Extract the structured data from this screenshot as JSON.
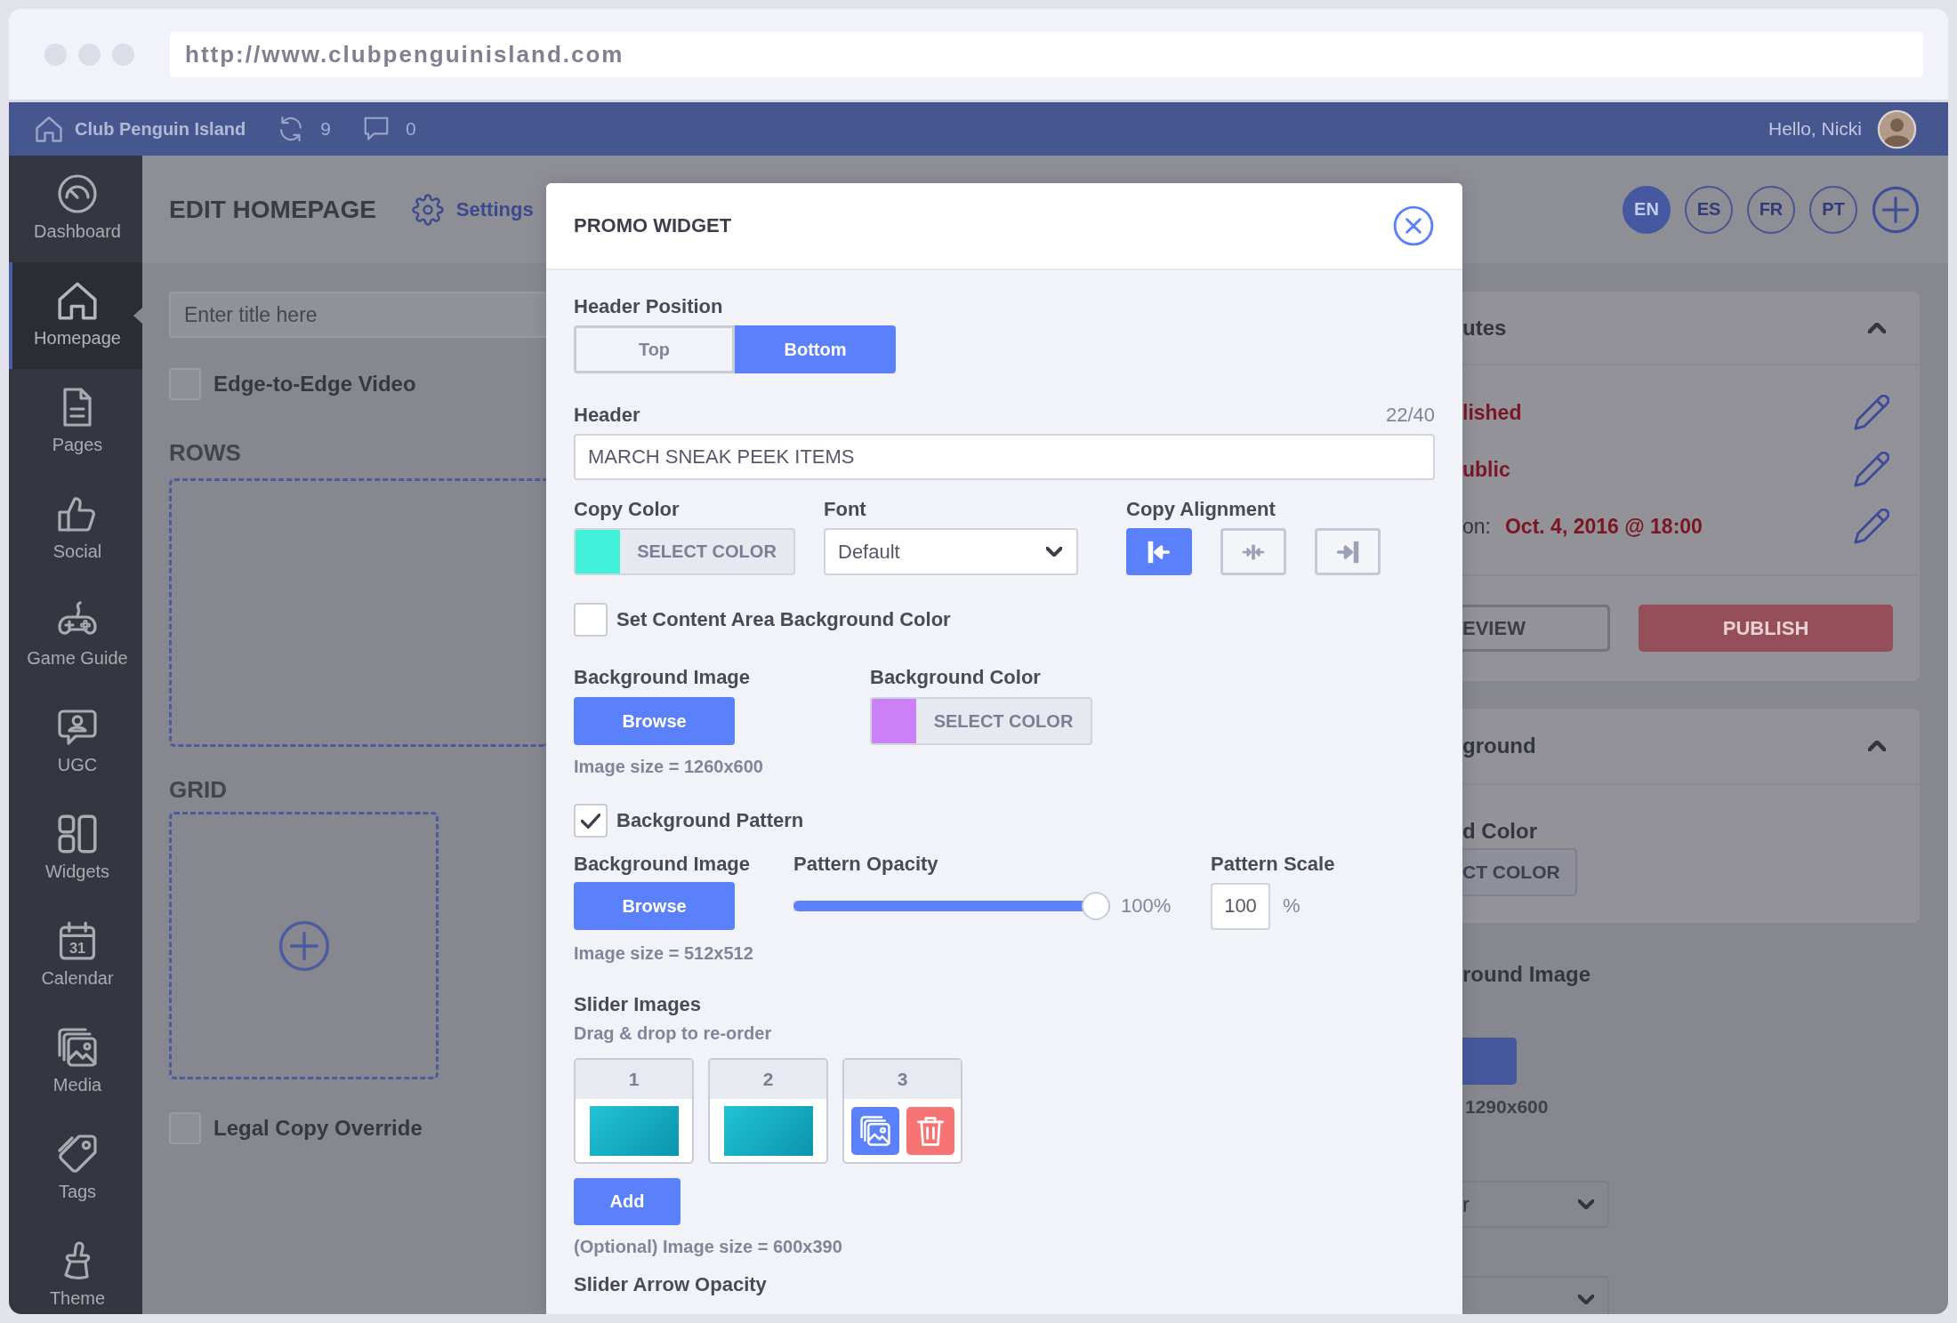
{
  "browser": {
    "url": "http://www.clubpenguinisland.com"
  },
  "top_bar": {
    "site_name": "Club Penguin Island",
    "notification_count": "9",
    "comment_count": "0",
    "greeting": "Hello, Nicki"
  },
  "sidebar": {
    "items": [
      {
        "label": "Dashboard",
        "selected": false
      },
      {
        "label": "Homepage",
        "selected": true
      },
      {
        "label": "Pages",
        "selected": false
      },
      {
        "label": "Social",
        "selected": false
      },
      {
        "label": "Game Guide",
        "selected": false
      },
      {
        "label": "UGC",
        "selected": false
      },
      {
        "label": "Widgets",
        "selected": false
      },
      {
        "label": "Calendar",
        "selected": false,
        "icon_text": "31"
      },
      {
        "label": "Media",
        "selected": false
      },
      {
        "label": "Tags",
        "selected": false
      },
      {
        "label": "Theme",
        "selected": false
      }
    ]
  },
  "page": {
    "title": "EDIT HOMEPAGE",
    "settings_link": "Settings",
    "title_field": {
      "placeholder": "Enter title here"
    },
    "edge_video": {
      "label": "Edge-to-Edge Video",
      "checked": false
    },
    "rows_heading": "ROWS",
    "grid_heading": "GRID",
    "legal_copy": {
      "label": "Legal Copy Override",
      "checked": false
    }
  },
  "languages": [
    {
      "code": "EN",
      "selected": true
    },
    {
      "code": "ES",
      "selected": false
    },
    {
      "code": "FR",
      "selected": false
    },
    {
      "code": "PT",
      "selected": false
    }
  ],
  "attributes_panel": {
    "title": "utes",
    "expanded": true,
    "rows": [
      {
        "value": "lished"
      },
      {
        "value": "ublic"
      },
      {
        "label": "on:",
        "value": "Oct. 4, 2016 @ 18:00"
      }
    ],
    "preview_button": "EVIEW",
    "publish_button": "PUBLISH"
  },
  "background_panel": {
    "title": "ground",
    "expanded": true,
    "color_label": "d Color",
    "color_button": "CT COLOR"
  },
  "background_image": {
    "label": "round Image",
    "size_hint": "1290x600",
    "dropdowns": [
      {
        "kind": "text",
        "value": "r"
      },
      {
        "kind": "blank"
      }
    ]
  },
  "modal": {
    "title": "PROMO WIDGET",
    "header_position": {
      "label": "Header Position",
      "options": [
        {
          "label": "Top",
          "selected": false
        },
        {
          "label": "Bottom",
          "selected": true
        }
      ]
    },
    "header": {
      "label": "Header",
      "counter": "22/40",
      "value": "MARCH SNEAK PEEK ITEMS"
    },
    "copy_color": {
      "label": "Copy Color",
      "color": "#40f0d8",
      "button": "SELECT COLOR"
    },
    "font": {
      "label": "Font",
      "value": "Default"
    },
    "copy_alignment": {
      "label": "Copy Alignment",
      "options": [
        {
          "kind": "left",
          "selected": true
        },
        {
          "kind": "center",
          "selected": false
        },
        {
          "kind": "right",
          "selected": false
        }
      ]
    },
    "content_background": {
      "label": "Set Content Area Background Color",
      "checked": false
    },
    "background_image": {
      "label": "Background Image",
      "button": "Browse",
      "hint": "Image size = 1260x600"
    },
    "background_color": {
      "label": "Background Color",
      "color": "#cc80f8",
      "button": "SELECT COLOR"
    },
    "background_pattern": {
      "label": "Background Pattern",
      "checked": true
    },
    "pattern_image": {
      "label": "Background Image",
      "button": "Browse",
      "hint": "Image size = 512x512"
    },
    "pattern_opacity": {
      "label": "Pattern Opacity",
      "level": 1,
      "reading": "100%"
    },
    "pattern_scale": {
      "label": "Pattern Scale",
      "value": "100",
      "unit": "%"
    },
    "slider_images": {
      "label": "Slider Images",
      "hint": "Drag & drop to re-order",
      "items": [
        {
          "number": "1",
          "kind": "image"
        },
        {
          "number": "2",
          "kind": "image"
        },
        {
          "number": "3",
          "kind": "actions"
        }
      ],
      "add_button": "Add",
      "size_hint": "(Optional) Image size = 600x390"
    },
    "slider_arrow_opacity": {
      "label": "Slider Arrow Opacity"
    }
  }
}
